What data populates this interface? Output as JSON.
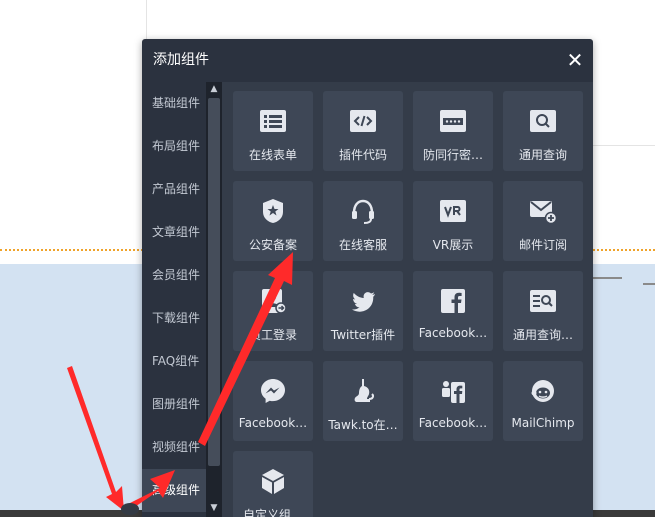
{
  "dialog": {
    "title": "添加组件",
    "close_label": "✕"
  },
  "sidebar": {
    "items": [
      {
        "label": "基础组件"
      },
      {
        "label": "布局组件"
      },
      {
        "label": "产品组件"
      },
      {
        "label": "文章组件"
      },
      {
        "label": "会员组件"
      },
      {
        "label": "下载组件"
      },
      {
        "label": "FAQ组件"
      },
      {
        "label": "图册组件"
      },
      {
        "label": "视频组件"
      },
      {
        "label": "高级组件",
        "active": true
      }
    ]
  },
  "scrollbar": {
    "up": "▲",
    "down": "▼"
  },
  "widgets": [
    {
      "label": "在线表单",
      "icon": "form-list-icon"
    },
    {
      "label": "插件代码",
      "icon": "code-icon"
    },
    {
      "label": "防同行密…",
      "icon": "password-icon"
    },
    {
      "label": "通用查询",
      "icon": "search-box-icon"
    },
    {
      "label": "公安备案",
      "icon": "police-badge-icon"
    },
    {
      "label": "在线客服",
      "icon": "headset-icon"
    },
    {
      "label": "VR展示",
      "icon": "vr-icon"
    },
    {
      "label": "邮件订阅",
      "icon": "mail-add-icon"
    },
    {
      "label": "员工登录",
      "icon": "staff-login-icon"
    },
    {
      "label": "Twitter插件",
      "icon": "twitter-icon"
    },
    {
      "label": "Facebook…",
      "icon": "facebook-icon"
    },
    {
      "label": "通用查询…",
      "icon": "query-list-icon"
    },
    {
      "label": "Facebook…",
      "icon": "messenger-icon"
    },
    {
      "label": "Tawk.to在…",
      "icon": "tawk-icon"
    },
    {
      "label": "Facebook…",
      "icon": "facebook-group-icon"
    },
    {
      "label": "MailChimp",
      "icon": "mailchimp-icon"
    },
    {
      "label": "自定义组…",
      "icon": "cube-icon"
    }
  ],
  "colors": {
    "panel_bg": "#2b323f",
    "tile_bg": "#3e4756",
    "annotation_arrow": "#ff2a2a"
  }
}
